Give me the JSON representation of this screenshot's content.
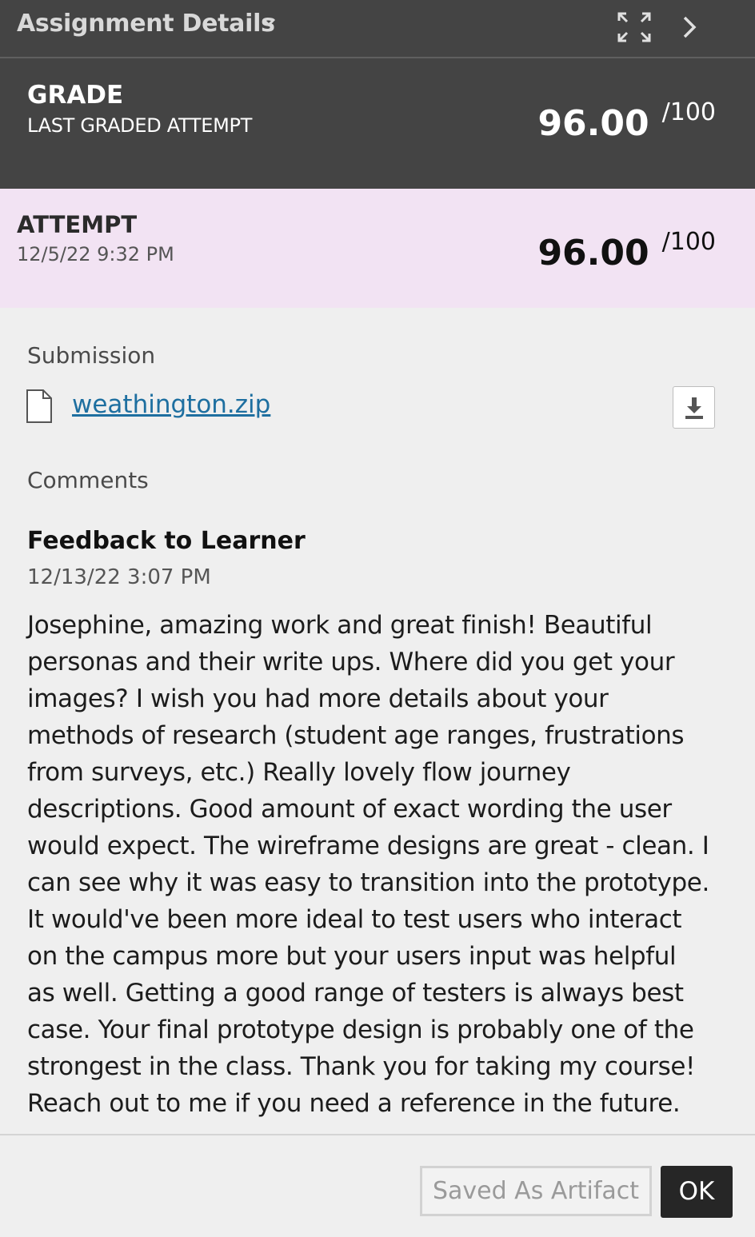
{
  "header": {
    "title": "Assignment Details"
  },
  "grade": {
    "label": "GRADE",
    "sublabel": "LAST GRADED ATTEMPT",
    "score": "96.00",
    "max": "/100"
  },
  "attempt": {
    "label": "ATTEMPT",
    "date": "12/5/22 9:32 PM",
    "score": "96.00",
    "max": "/100"
  },
  "submission": {
    "label": "Submission",
    "file_name": "weathington.zip"
  },
  "comments": {
    "label": "Comments",
    "feedback_title": "Feedback to Learner",
    "feedback_date": "12/13/22 3:07 PM",
    "feedback_lines": [
      "Josephine, amazing work and great finish! Beautiful",
      "personas and their write ups. Where did you get your",
      "images? I wish you had more details about your",
      "methods of research (student age ranges, frustrations",
      "from surveys, etc.) Really lovely flow journey",
      "descriptions. Good amount of exact wording the user",
      "would expect. The wireframe designs are great - clean. I",
      "can see why it was easy to transition into the prototype.",
      "It would've been more ideal to test users who interact",
      "on the campus more but your users input was helpful",
      "as well. Getting a good range of testers is always best",
      "case. Your final prototype design is probably one of the",
      "strongest in the class. Thank you for taking my course!",
      "Reach out to me if you need a reference in the future."
    ]
  },
  "footer": {
    "saved_label": "Saved As Artifact",
    "ok_label": "OK"
  },
  "icons": {
    "chevron_down": "chevron-down-icon",
    "expand": "expand-icon",
    "next": "chevron-right-icon",
    "file": "file-icon",
    "download": "download-icon"
  },
  "colors": {
    "header_bg": "#444444",
    "attempt_bg": "#f2e3f3",
    "link": "#1e6fa0",
    "ok_bg": "#262626"
  }
}
